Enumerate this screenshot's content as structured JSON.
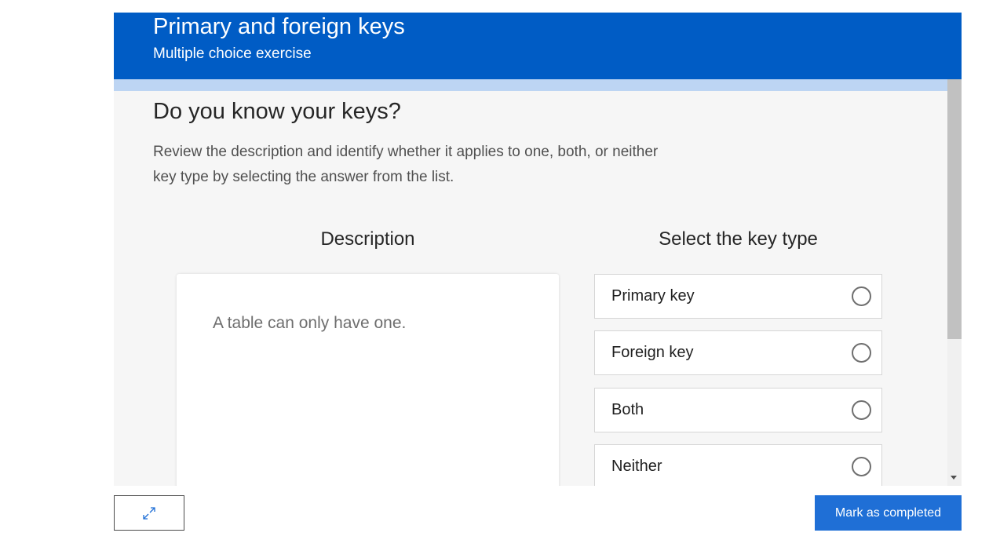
{
  "header": {
    "title": "Primary and foreign keys",
    "subtitle": "Multiple choice exercise"
  },
  "question": {
    "title": "Do you know your keys?",
    "instructions": "Review the description and identify whether it applies to one, both, or neither key type by selecting the answer from the list."
  },
  "columns": {
    "description_heading": "Description",
    "select_heading": "Select the key type"
  },
  "description_card": {
    "text": "A table can only have one."
  },
  "options": [
    {
      "label": "Primary key",
      "selected": false
    },
    {
      "label": "Foreign key",
      "selected": false
    },
    {
      "label": "Both",
      "selected": false
    },
    {
      "label": "Neither",
      "selected": false
    }
  ],
  "footer": {
    "expand_icon": "expand-arrows-icon",
    "complete_label": "Mark as completed"
  },
  "colors": {
    "header_bg": "#005cc5",
    "progress_track": "#bdd5f3",
    "content_bg": "#f6f6f6",
    "complete_button_bg": "#1f6fd6"
  }
}
